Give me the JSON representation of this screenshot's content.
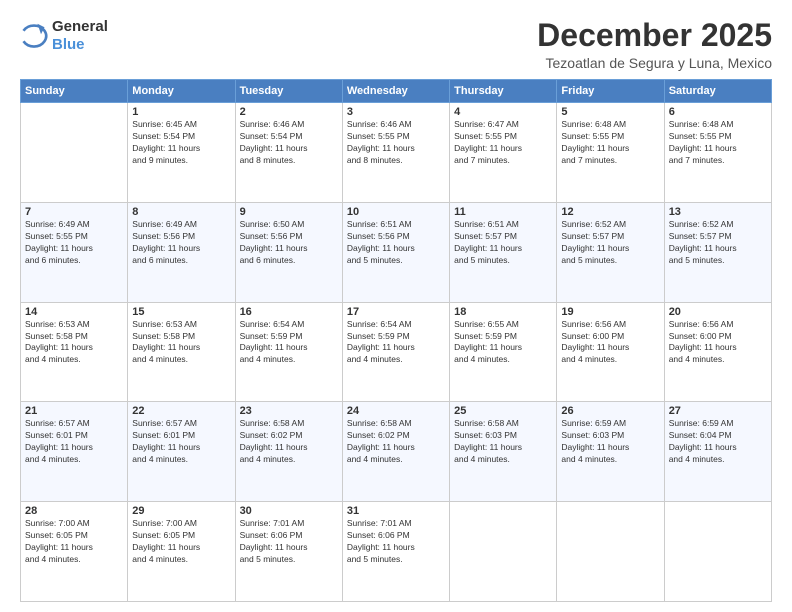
{
  "header": {
    "logo_general": "General",
    "logo_blue": "Blue",
    "month": "December 2025",
    "location": "Tezoatlan de Segura y Luna, Mexico"
  },
  "days_of_week": [
    "Sunday",
    "Monday",
    "Tuesday",
    "Wednesday",
    "Thursday",
    "Friday",
    "Saturday"
  ],
  "weeks": [
    [
      {
        "day": "",
        "info": ""
      },
      {
        "day": "1",
        "info": "Sunrise: 6:45 AM\nSunset: 5:54 PM\nDaylight: 11 hours\nand 9 minutes."
      },
      {
        "day": "2",
        "info": "Sunrise: 6:46 AM\nSunset: 5:54 PM\nDaylight: 11 hours\nand 8 minutes."
      },
      {
        "day": "3",
        "info": "Sunrise: 6:46 AM\nSunset: 5:55 PM\nDaylight: 11 hours\nand 8 minutes."
      },
      {
        "day": "4",
        "info": "Sunrise: 6:47 AM\nSunset: 5:55 PM\nDaylight: 11 hours\nand 7 minutes."
      },
      {
        "day": "5",
        "info": "Sunrise: 6:48 AM\nSunset: 5:55 PM\nDaylight: 11 hours\nand 7 minutes."
      },
      {
        "day": "6",
        "info": "Sunrise: 6:48 AM\nSunset: 5:55 PM\nDaylight: 11 hours\nand 7 minutes."
      }
    ],
    [
      {
        "day": "7",
        "info": "Sunrise: 6:49 AM\nSunset: 5:55 PM\nDaylight: 11 hours\nand 6 minutes."
      },
      {
        "day": "8",
        "info": "Sunrise: 6:49 AM\nSunset: 5:56 PM\nDaylight: 11 hours\nand 6 minutes."
      },
      {
        "day": "9",
        "info": "Sunrise: 6:50 AM\nSunset: 5:56 PM\nDaylight: 11 hours\nand 6 minutes."
      },
      {
        "day": "10",
        "info": "Sunrise: 6:51 AM\nSunset: 5:56 PM\nDaylight: 11 hours\nand 5 minutes."
      },
      {
        "day": "11",
        "info": "Sunrise: 6:51 AM\nSunset: 5:57 PM\nDaylight: 11 hours\nand 5 minutes."
      },
      {
        "day": "12",
        "info": "Sunrise: 6:52 AM\nSunset: 5:57 PM\nDaylight: 11 hours\nand 5 minutes."
      },
      {
        "day": "13",
        "info": "Sunrise: 6:52 AM\nSunset: 5:57 PM\nDaylight: 11 hours\nand 5 minutes."
      }
    ],
    [
      {
        "day": "14",
        "info": "Sunrise: 6:53 AM\nSunset: 5:58 PM\nDaylight: 11 hours\nand 4 minutes."
      },
      {
        "day": "15",
        "info": "Sunrise: 6:53 AM\nSunset: 5:58 PM\nDaylight: 11 hours\nand 4 minutes."
      },
      {
        "day": "16",
        "info": "Sunrise: 6:54 AM\nSunset: 5:59 PM\nDaylight: 11 hours\nand 4 minutes."
      },
      {
        "day": "17",
        "info": "Sunrise: 6:54 AM\nSunset: 5:59 PM\nDaylight: 11 hours\nand 4 minutes."
      },
      {
        "day": "18",
        "info": "Sunrise: 6:55 AM\nSunset: 5:59 PM\nDaylight: 11 hours\nand 4 minutes."
      },
      {
        "day": "19",
        "info": "Sunrise: 6:56 AM\nSunset: 6:00 PM\nDaylight: 11 hours\nand 4 minutes."
      },
      {
        "day": "20",
        "info": "Sunrise: 6:56 AM\nSunset: 6:00 PM\nDaylight: 11 hours\nand 4 minutes."
      }
    ],
    [
      {
        "day": "21",
        "info": "Sunrise: 6:57 AM\nSunset: 6:01 PM\nDaylight: 11 hours\nand 4 minutes."
      },
      {
        "day": "22",
        "info": "Sunrise: 6:57 AM\nSunset: 6:01 PM\nDaylight: 11 hours\nand 4 minutes."
      },
      {
        "day": "23",
        "info": "Sunrise: 6:58 AM\nSunset: 6:02 PM\nDaylight: 11 hours\nand 4 minutes."
      },
      {
        "day": "24",
        "info": "Sunrise: 6:58 AM\nSunset: 6:02 PM\nDaylight: 11 hours\nand 4 minutes."
      },
      {
        "day": "25",
        "info": "Sunrise: 6:58 AM\nSunset: 6:03 PM\nDaylight: 11 hours\nand 4 minutes."
      },
      {
        "day": "26",
        "info": "Sunrise: 6:59 AM\nSunset: 6:03 PM\nDaylight: 11 hours\nand 4 minutes."
      },
      {
        "day": "27",
        "info": "Sunrise: 6:59 AM\nSunset: 6:04 PM\nDaylight: 11 hours\nand 4 minutes."
      }
    ],
    [
      {
        "day": "28",
        "info": "Sunrise: 7:00 AM\nSunset: 6:05 PM\nDaylight: 11 hours\nand 4 minutes."
      },
      {
        "day": "29",
        "info": "Sunrise: 7:00 AM\nSunset: 6:05 PM\nDaylight: 11 hours\nand 4 minutes."
      },
      {
        "day": "30",
        "info": "Sunrise: 7:01 AM\nSunset: 6:06 PM\nDaylight: 11 hours\nand 5 minutes."
      },
      {
        "day": "31",
        "info": "Sunrise: 7:01 AM\nSunset: 6:06 PM\nDaylight: 11 hours\nand 5 minutes."
      },
      {
        "day": "",
        "info": ""
      },
      {
        "day": "",
        "info": ""
      },
      {
        "day": "",
        "info": ""
      }
    ]
  ]
}
